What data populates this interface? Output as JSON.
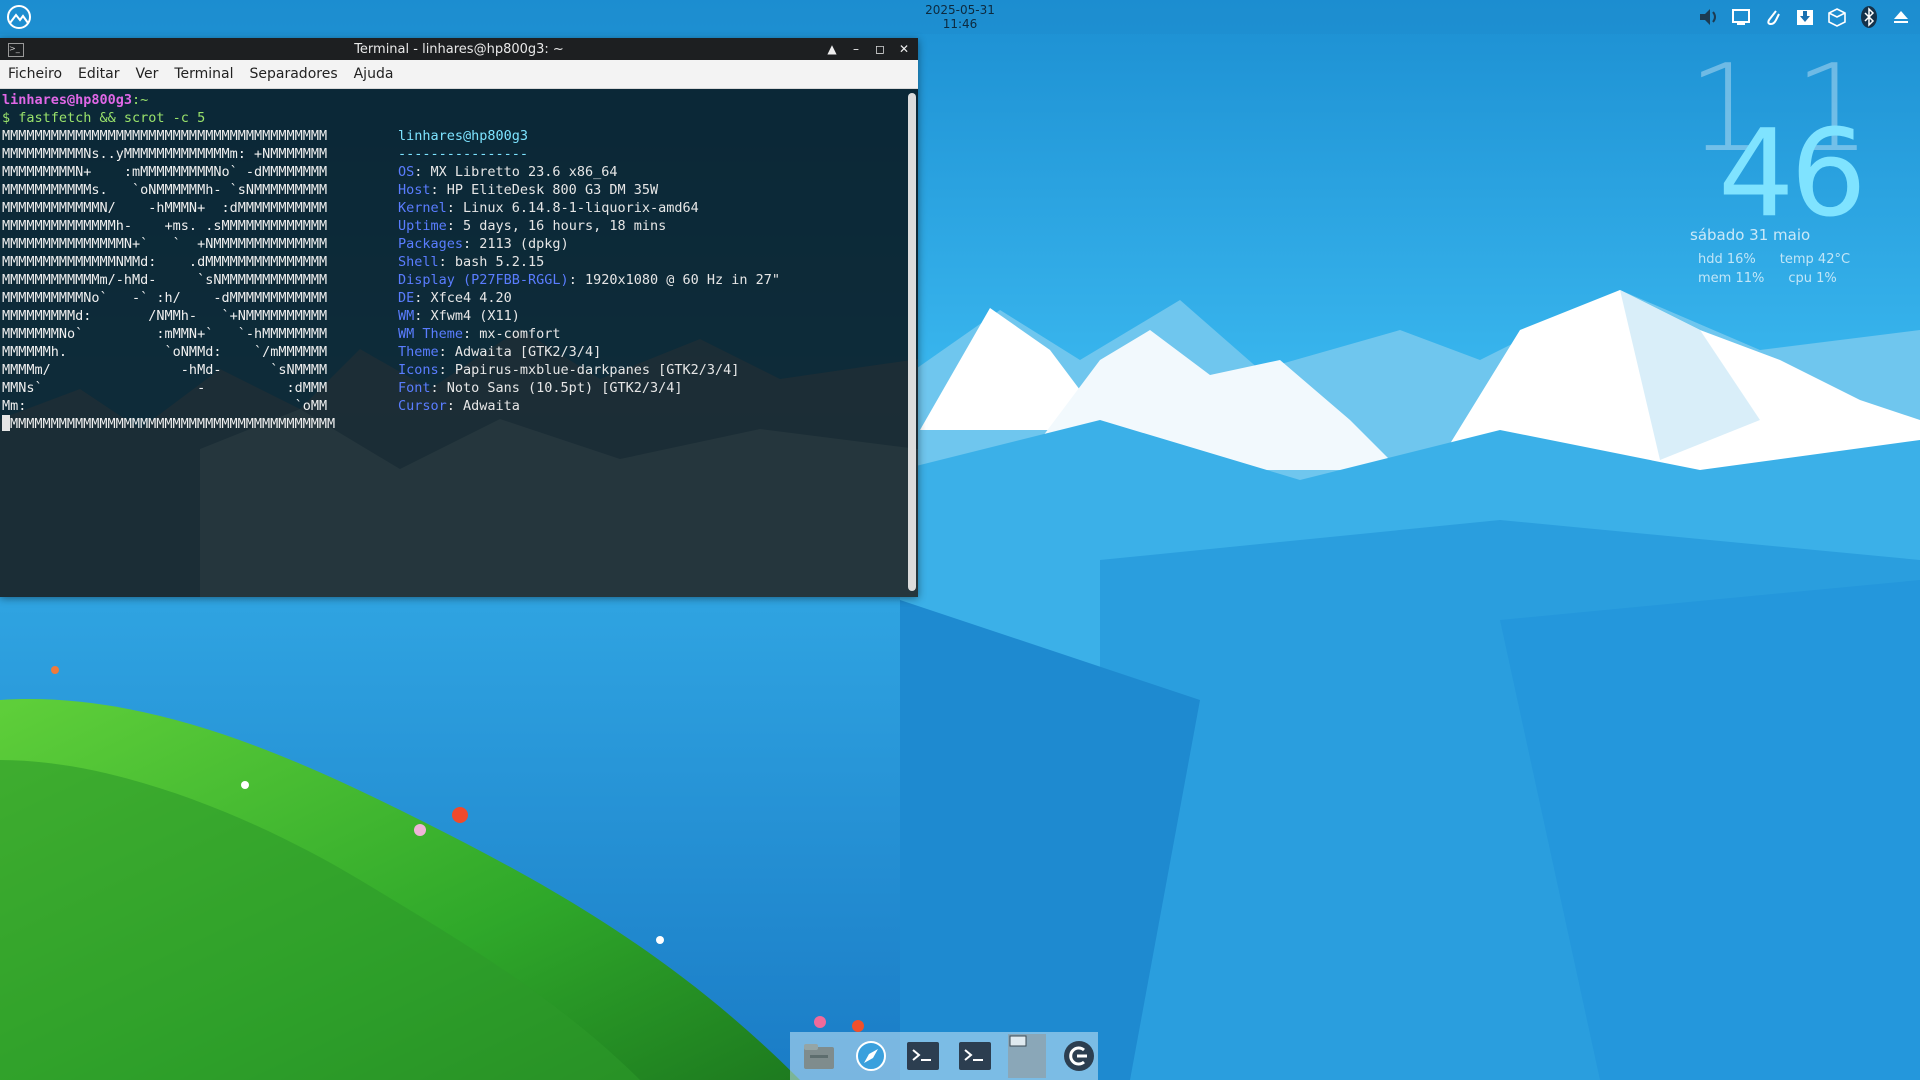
{
  "panel": {
    "date": "2025-05-31",
    "time": "11:46",
    "tray_icons": [
      "volume-icon",
      "display-icon",
      "clip-icon",
      "updates-icon",
      "package-icon",
      "bluetooth-icon",
      "eject-icon"
    ]
  },
  "desktop_clock": {
    "hour": "11",
    "minute": "46",
    "date": "sábado  31 maio",
    "sysmon": {
      "hdd": "hdd  16%",
      "temp": "temp  42°C",
      "mem": "mem  11%",
      "cpu": "cpu  1%"
    }
  },
  "terminal": {
    "title": "Terminal - linhares@hp800g3: ~",
    "menu": [
      "Ficheiro",
      "Editar",
      "Ver",
      "Terminal",
      "Separadores",
      "Ajuda"
    ],
    "prompt_user": "linhares@hp800g3",
    "prompt_path": ":~",
    "command": "$ fastfetch && scrot -c 5",
    "logo_lines": [
      "MMMMMMMMMMMMMMMMMMMMMMMMMMMMMMMMMMMMMMMM",
      "MMMMMMMMMMNs..yMMMMMMMMMMMMMm: +NMMMMMMM",
      "MMMMMMMMMN+    :mMMMMMMMMMNo` -dMMMMMMMM",
      "MMMMMMMMMMMs.   `oNMMMMMMh- `sNMMMMMMMMM",
      "MMMMMMMMMMMMN/    -hMMMN+  :dMMMMMMMMMMM",
      "MMMMMMMMMMMMMMh-    +ms. .sMMMMMMMMMMMMM",
      "MMMMMMMMMMMMMMMN+`   `  +NMMMMMMMMMMMMMM",
      "MMMMMMMMMMMMMMNMMd:    .dMMMMMMMMMMMMMMM",
      "MMMMMMMMMMMMm/-hMd-     `sNMMMMMMMMMMMMM",
      "MMMMMMMMMMNo`   -` :h/    -dMMMMMMMMMMMM",
      "MMMMMMMMMd:       /NMMh-   `+NMMMMMMMMMM",
      "MMMMMMMNo`         :mMMN+`   `-hMMMMMMMM",
      "MMMMMMh.            `oNMMd:    `/mMMMMMM",
      "MMMMm/                -hMd-      `sNMMMM",
      "MMNs`                   -          :dMMM",
      "Mm:                                 `oMM",
      "MMMMMMMMMMMMMMMMMMMMMMMMMMMMMMMMMMMMMMMM"
    ],
    "info_header": "linhares@hp800g3",
    "info_sep": "----------------",
    "info": [
      {
        "k": "OS",
        "v": ": MX Libretto 23.6 x86_64"
      },
      {
        "k": "Host",
        "v": ": HP EliteDesk 800 G3 DM 35W"
      },
      {
        "k": "Kernel",
        "v": ": Linux 6.14.8-1-liquorix-amd64"
      },
      {
        "k": "Uptime",
        "v": ": 5 days, 16 hours, 18 mins"
      },
      {
        "k": "Packages",
        "v": ": 2113 (dpkg)"
      },
      {
        "k": "Shell",
        "v": ": bash 5.2.15"
      },
      {
        "k": "Display (P27FBB-RGGL)",
        "v": ": 1920x1080 @ 60 Hz in 27\""
      },
      {
        "k": "DE",
        "v": ": Xfce4 4.20"
      },
      {
        "k": "WM",
        "v": ": Xfwm4 (X11)"
      },
      {
        "k": "WM Theme",
        "v": ": mx-comfort"
      },
      {
        "k": "Theme",
        "v": ": Adwaita [GTK2/3/4]"
      },
      {
        "k": "Icons",
        "v": ": Papirus-mxblue-darkpanes [GTK2/3/4]"
      },
      {
        "k": "Font",
        "v": ": Noto Sans (10.5pt) [GTK2/3/4]"
      },
      {
        "k": "Cursor",
        "v": ": Adwaita"
      }
    ]
  },
  "dock_icons": [
    "file-manager-icon",
    "browser-icon",
    "terminal-icon",
    "terminal-active-icon",
    "workspace-icon",
    "logout-icon"
  ]
}
